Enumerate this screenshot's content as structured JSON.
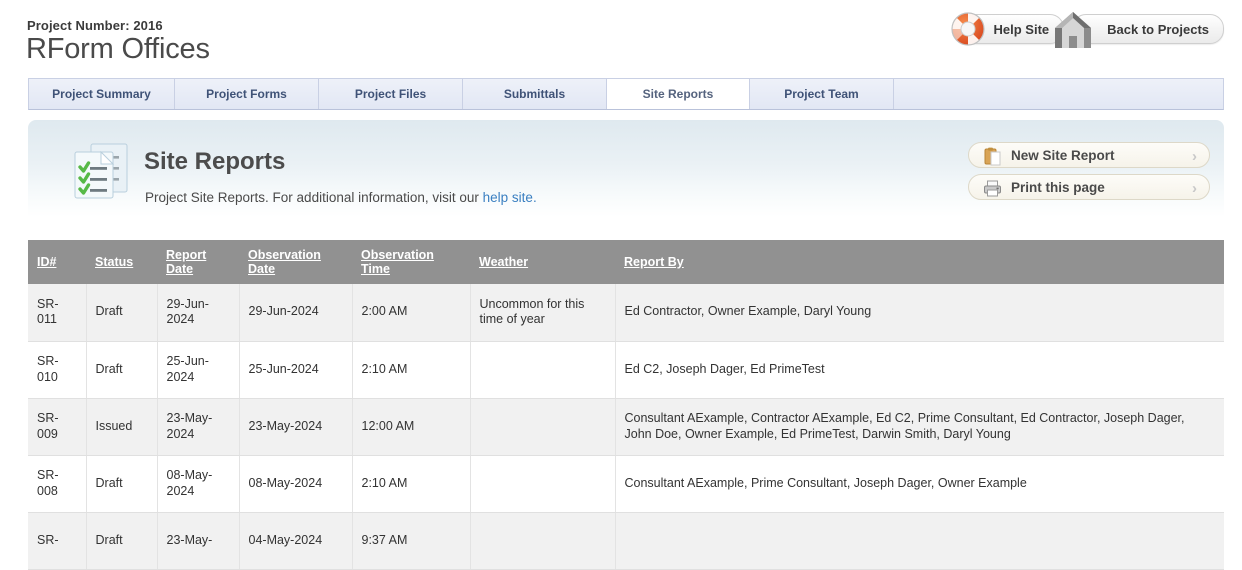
{
  "header": {
    "project_number_label": "Project Number: 2016",
    "project_title": "RForm Offices",
    "help_button": "Help Site",
    "back_button": "Back to Projects"
  },
  "tabs": [
    {
      "label": "Project Summary",
      "active": false
    },
    {
      "label": "Project Forms",
      "active": false
    },
    {
      "label": "Project Files",
      "active": false
    },
    {
      "label": "Submittals",
      "active": false
    },
    {
      "label": "Site Reports",
      "active": true
    },
    {
      "label": "Project Team",
      "active": false
    }
  ],
  "section": {
    "title": "Site Reports",
    "description_before": "Project Site Reports. For additional information, visit our ",
    "description_link": "help site.",
    "actions": [
      {
        "label": "New Site Report",
        "icon": "clipboard-icon",
        "chevron": "›"
      },
      {
        "label": "Print this page",
        "icon": "printer-icon",
        "chevron": "›"
      }
    ]
  },
  "table": {
    "columns": [
      "ID#",
      "Status",
      "Report Date",
      "Observation Date",
      "Observation Time",
      "Weather",
      "Report By"
    ],
    "columns_split": [
      [
        "ID#"
      ],
      [
        "Status"
      ],
      [
        "Report",
        "Date"
      ],
      [
        "Observation",
        "Date"
      ],
      [
        "Observation",
        "Time"
      ],
      [
        "Weather"
      ],
      [
        "Report By"
      ]
    ],
    "rows": [
      {
        "id": "SR-011",
        "status": "Draft",
        "report_date": "29-Jun-2024",
        "observation_date": "29-Jun-2024",
        "observation_time": "2:00 AM",
        "weather": "Uncommon for this time of year",
        "report_by": "Ed Contractor, Owner Example, Daryl Young"
      },
      {
        "id": "SR-010",
        "status": "Draft",
        "report_date": "25-Jun-2024",
        "observation_date": "25-Jun-2024",
        "observation_time": "2:10 AM",
        "weather": "",
        "report_by": "Ed C2, Joseph Dager, Ed PrimeTest"
      },
      {
        "id": "SR-009",
        "status": "Issued",
        "report_date": "23-May-2024",
        "observation_date": "23-May-2024",
        "observation_time": "12:00 AM",
        "weather": "",
        "report_by": "Consultant AExample, Contractor AExample, Ed C2, Prime Consultant, Ed Contractor, Joseph Dager, John Doe, Owner Example, Ed PrimeTest, Darwin Smith, Daryl Young"
      },
      {
        "id": "SR-008",
        "status": "Draft",
        "report_date": "08-May-2024",
        "observation_date": "08-May-2024",
        "observation_time": "2:10 AM",
        "weather": "",
        "report_by": "Consultant AExample, Prime Consultant, Joseph Dager, Owner Example"
      },
      {
        "id": "SR-",
        "status": "Draft",
        "report_date": "23-May-",
        "observation_date": "04-May-2024",
        "observation_time": "9:37 AM",
        "weather": "",
        "report_by": ""
      }
    ]
  },
  "colors": {
    "table_header_bg": "#919191",
    "tab_active_bg": "#ffffff",
    "tab_text": "#3f5277",
    "link_blue": "#3a7fc1",
    "row_alt_bg": "#f1f1f1",
    "panel_top": "#dfe9ef"
  }
}
